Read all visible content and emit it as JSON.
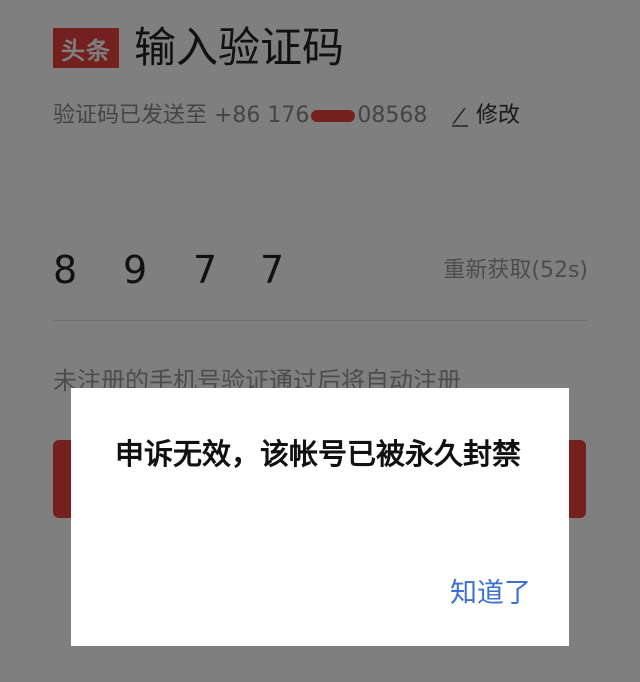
{
  "header": {
    "logo_text": "头条",
    "title": "输入验证码"
  },
  "phone": {
    "sent_prefix": "验证码已发送至 +86 17",
    "digits_before": "6",
    "digits_after": "08568",
    "edit_label": "修改"
  },
  "code": {
    "digits": [
      "8",
      "9",
      "7",
      "7"
    ],
    "resend_label": "重新获取(52s)"
  },
  "notice": "未注册的手机号验证通过后将自动注册",
  "dialog": {
    "message": "申诉无效，该帐号已被永久封禁",
    "confirm_label": "知道了"
  },
  "colors": {
    "brand": "#e8403c",
    "link": "#3a6fd6"
  }
}
